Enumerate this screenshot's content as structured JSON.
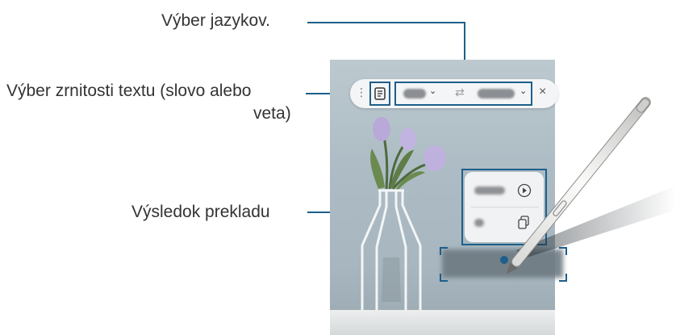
{
  "callouts": {
    "language_selection": "Výber jazykov.",
    "text_granularity_line1": "Výber zrnitosti textu (slovo alebo",
    "text_granularity_line2": "veta)",
    "translation_result": "Výsledok prekladu"
  },
  "toolbar": {
    "more_icon": "more-vertical-icon",
    "granularity_icon": "document-text-icon",
    "swap_icon": "swap-arrows-icon",
    "close_icon": "close-icon"
  },
  "result_popup": {
    "play_icon": "play-circle-icon",
    "copy_icon": "copy-icon"
  },
  "colors": {
    "callout_line": "#1d5f8a",
    "toolbar_bg": "#f4f5f6",
    "label_text": "#333333"
  }
}
